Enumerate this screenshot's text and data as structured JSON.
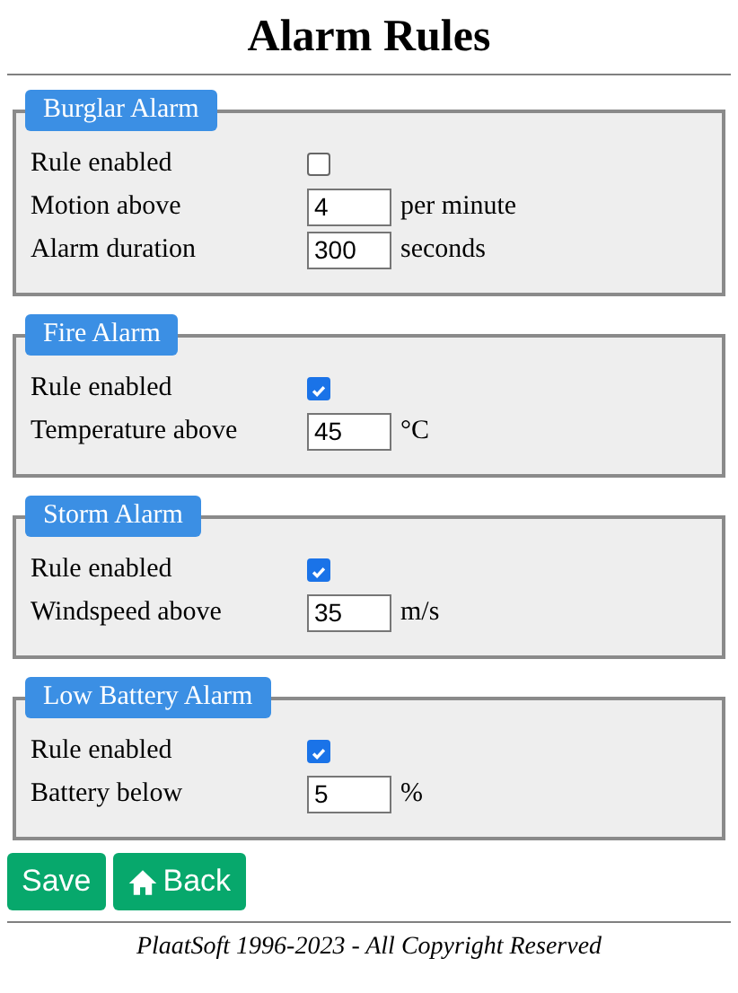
{
  "title": "Alarm Rules",
  "sections": [
    {
      "legend": "Burglar Alarm",
      "rows": [
        {
          "kind": "checkbox",
          "label": "Rule enabled",
          "checked": false
        },
        {
          "kind": "number",
          "label": "Motion above",
          "value": "4",
          "unit": "per minute"
        },
        {
          "kind": "number",
          "label": "Alarm duration",
          "value": "300",
          "unit": "seconds"
        }
      ]
    },
    {
      "legend": "Fire Alarm",
      "rows": [
        {
          "kind": "checkbox",
          "label": "Rule enabled",
          "checked": true
        },
        {
          "kind": "number",
          "label": "Temperature above",
          "value": "45",
          "unit": "°C"
        }
      ]
    },
    {
      "legend": "Storm Alarm",
      "rows": [
        {
          "kind": "checkbox",
          "label": "Rule enabled",
          "checked": true
        },
        {
          "kind": "number",
          "label": "Windspeed above",
          "value": "35",
          "unit": "m/s"
        }
      ]
    },
    {
      "legend": "Low Battery Alarm",
      "rows": [
        {
          "kind": "checkbox",
          "label": "Rule enabled",
          "checked": true
        },
        {
          "kind": "number",
          "label": "Battery below",
          "value": "5",
          "unit": "%"
        }
      ]
    }
  ],
  "buttons": [
    {
      "kind": "save",
      "label": "Save"
    },
    {
      "kind": "home",
      "label": "Back"
    }
  ],
  "footer": "PlaatSoft 1996-2023 - All Copyright Reserved"
}
